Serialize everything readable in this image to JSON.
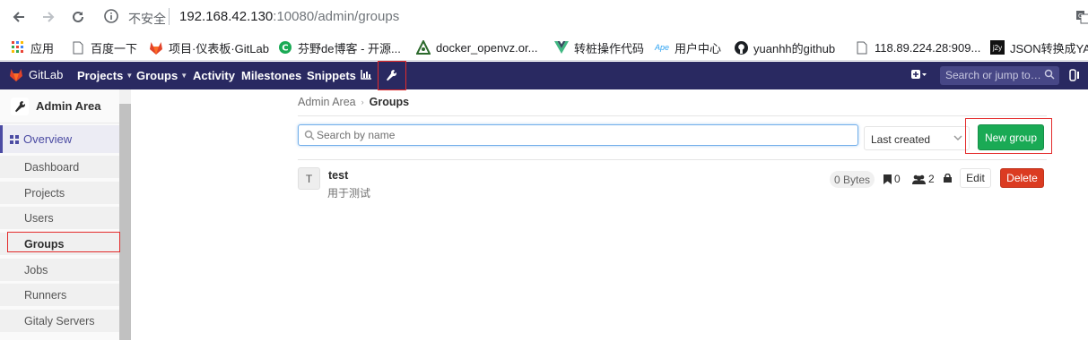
{
  "browser": {
    "insecure_label": "不安全",
    "url_host": "192.168.42.130",
    "url_rest": ":10080/admin/groups"
  },
  "bookmarks": [
    {
      "label": "应用",
      "icon": "apps-grid-icon"
    },
    {
      "label": "百度一下",
      "icon": "page-icon"
    },
    {
      "label": "项目·仪表板·GitLab",
      "icon": "gitlab-fox-icon"
    },
    {
      "label": "芬野de博客 - 开源...",
      "icon": "c-logo-icon"
    },
    {
      "label": "docker_openvz.or...",
      "icon": "tree-logo-icon"
    },
    {
      "label": "转桩操作代码",
      "icon": "vue-logo-icon"
    },
    {
      "label": "用户中心",
      "icon": "ape-logo-icon"
    },
    {
      "label": "yuanhh的github",
      "icon": "github-icon"
    },
    {
      "label": "118.89.224.28:909...",
      "icon": "page-icon"
    },
    {
      "label": "JSON转换成YAML",
      "icon": "json-logo-icon"
    }
  ],
  "header": {
    "logo_text": "GitLab",
    "nav": {
      "projects": "Projects",
      "groups": "Groups",
      "activity": "Activity",
      "milestones": "Milestones",
      "snippets": "Snippets"
    },
    "search_placeholder": "Search or jump to…"
  },
  "sidebar": {
    "title": "Admin Area",
    "overview": "Overview",
    "items": [
      "Dashboard",
      "Projects",
      "Users",
      "Groups",
      "Jobs",
      "Runners",
      "Gitaly Servers"
    ],
    "active": "Groups"
  },
  "breadcrumb": {
    "parent": "Admin Area",
    "current": "Groups"
  },
  "filter": {
    "search_placeholder": "Search by name",
    "sort_value": "Last created",
    "new_group_label": "New group"
  },
  "groups": [
    {
      "avatar_letter": "T",
      "name": "test",
      "description": "用于测试",
      "size": "0 Bytes",
      "projects": "0",
      "members": "2",
      "edit_label": "Edit",
      "delete_label": "Delete"
    }
  ],
  "colors": {
    "header_bg": "#292961",
    "accent": "#4b4ba3",
    "success": "#1aaa55",
    "danger": "#db3b21",
    "highlight_box": "#e32b2b"
  }
}
